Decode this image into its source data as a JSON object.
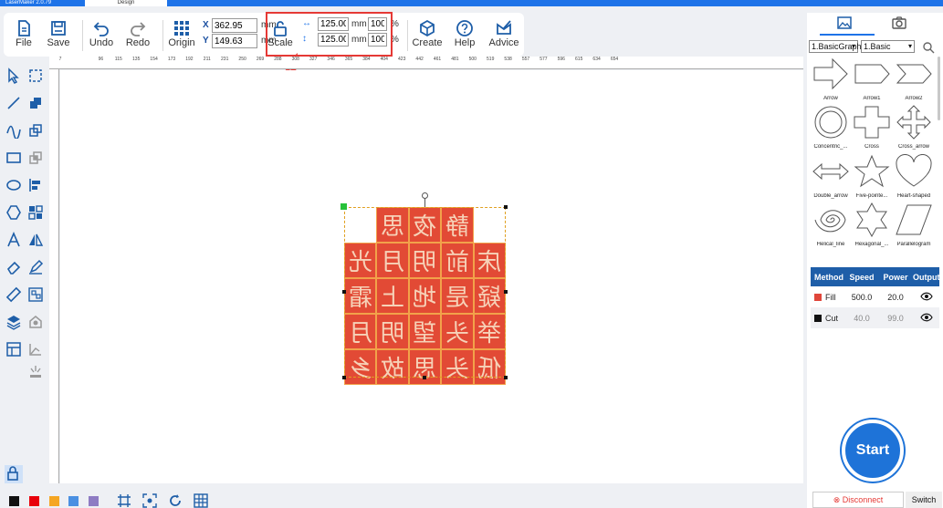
{
  "titlebar": {
    "app_tab": "LaserMaker 2.0.79",
    "design_tab": "Design"
  },
  "toolbar": {
    "file": "File",
    "save": "Save",
    "undo": "Undo",
    "redo": "Redo",
    "origin": "Origin",
    "x_label": "X",
    "x_value": "362.95",
    "y_label": "Y",
    "y_value": "149.63",
    "unit": "mm",
    "scale": "Scale",
    "width_value": "125.00",
    "height_value": "125.00",
    "width_pct": "100",
    "height_pct": "100",
    "pct": "%",
    "create": "Create",
    "help": "Help",
    "advice": "Advice"
  },
  "ruler": {
    "h_ticks": [
      "7",
      "96",
      "115",
      "135",
      "154",
      "173",
      "192",
      "211",
      "231",
      "250",
      "269",
      "288",
      "308",
      "327",
      "346",
      "365",
      "384",
      "404",
      "423",
      "442",
      "461",
      "481",
      "500",
      "519",
      "538",
      "557",
      "577",
      "596",
      "615",
      "634",
      "654"
    ]
  },
  "design": {
    "rows": [
      [
        "",
        "思",
        "夜",
        "静",
        ""
      ],
      [
        "光",
        "月",
        "明",
        "前",
        "床"
      ],
      [
        "霜",
        "上",
        "地",
        "是",
        "疑"
      ],
      [
        "月",
        "明",
        "望",
        "头",
        "举"
      ],
      [
        "乡",
        "故",
        "思",
        "头",
        "低"
      ]
    ]
  },
  "colors": {
    "palette": [
      "#111111",
      "#e8000b",
      "#f5a623",
      "#4a90e2",
      "#8e7cc3"
    ]
  },
  "library": {
    "category": "1.BasicGraph",
    "subcategory": "1.Basic",
    "shapes": [
      "Arrow",
      "Arrow1",
      "Arrow2",
      "Concentric_...",
      "Cross",
      "Cross_arrow",
      "Double_arrow",
      "Five-pointe...",
      "Heart-shaped",
      "Helical_line",
      "Hexagonal_...",
      "Parallelogram"
    ]
  },
  "layers": {
    "headers": [
      "Method",
      "Speed",
      "Power",
      "Output"
    ],
    "rows": [
      {
        "method": "Fill",
        "speed": "500.0",
        "power": "20.0",
        "color": "#e0463a"
      },
      {
        "method": "Cut",
        "speed": "40.0",
        "power": "99.0",
        "color": "#111111"
      }
    ]
  },
  "footer": {
    "start": "Start",
    "disconnect": "Disconnect",
    "switch": "Switch"
  }
}
